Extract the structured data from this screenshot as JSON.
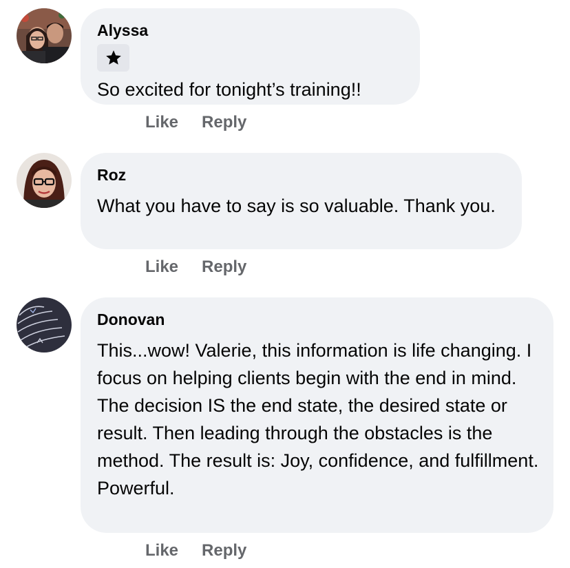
{
  "comments": [
    {
      "author": "Alyssa",
      "badge_icon": "star-icon",
      "text": "So excited for tonight’s training!!",
      "actions": {
        "like": "Like",
        "reply": "Reply"
      }
    },
    {
      "author": "Roz",
      "text": "What you have to say is so valuable.  Thank you.",
      "actions": {
        "like": "Like",
        "reply": "Reply"
      }
    },
    {
      "author": "Donovan",
      "text": "This...wow!   Valerie, this information is life changing.  I focus on helping clients begin with the end in mind.   The decision IS the end state, the desired state or result.   Then leading through the obstacles is the method.  The result is:  Joy, confidence, and fulfillment.  Powerful.",
      "actions": {
        "like": "Like",
        "reply": "Reply"
      }
    }
  ]
}
